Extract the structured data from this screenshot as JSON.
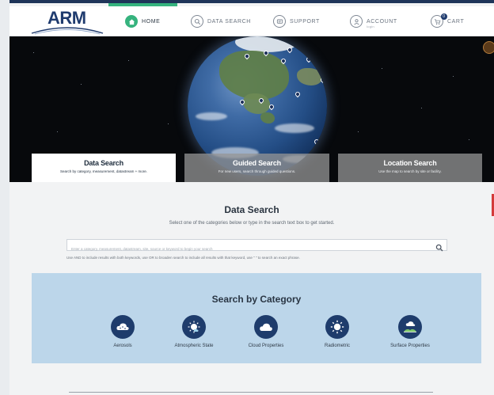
{
  "brand": {
    "logo_text": "ARM",
    "colors": {
      "navy": "#1f3b6e",
      "green": "#36b37e",
      "panel": "#bcd6ea"
    }
  },
  "nav": {
    "items": [
      {
        "label": "HOME",
        "icon": "home-icon",
        "active": true
      },
      {
        "label": "DATA SEARCH",
        "icon": "search-icon"
      },
      {
        "label": "SUPPORT",
        "icon": "support-icon"
      },
      {
        "label": "ACCOUNT",
        "sub": "login",
        "icon": "user-icon"
      },
      {
        "label": "CART",
        "icon": "cart-icon",
        "badge": "0"
      }
    ]
  },
  "hero": {
    "tabs": [
      {
        "title": "Data Search",
        "desc": "Search by category, measurement, datastream + more.",
        "active": true
      },
      {
        "title": "Guided Search",
        "desc": "For new users, search through guided questions."
      },
      {
        "title": "Location Search",
        "desc": "Use the map to search by site or facility."
      }
    ]
  },
  "main": {
    "title": "Data Search",
    "subtitle": "Select one of the categories below or type in the search text box to get started.",
    "search": {
      "placeholder": "Enter a category, measurement, datastream, site, source or keyword to begin your search"
    },
    "help": "Use AND to include results with both keywords, use OR to broaden search to include all results with that keyword, use \" \" to search an exact phrase."
  },
  "categories": {
    "title": "Search by Category",
    "items": [
      {
        "label": "Aerosols",
        "icon": "aerosols-icon"
      },
      {
        "label": "Atmospheric State",
        "icon": "atmospheric-state-icon"
      },
      {
        "label": "Cloud Properties",
        "icon": "cloud-icon"
      },
      {
        "label": "Radiometric",
        "icon": "sun-icon"
      },
      {
        "label": "Surface Properties",
        "icon": "surface-icon"
      }
    ]
  }
}
